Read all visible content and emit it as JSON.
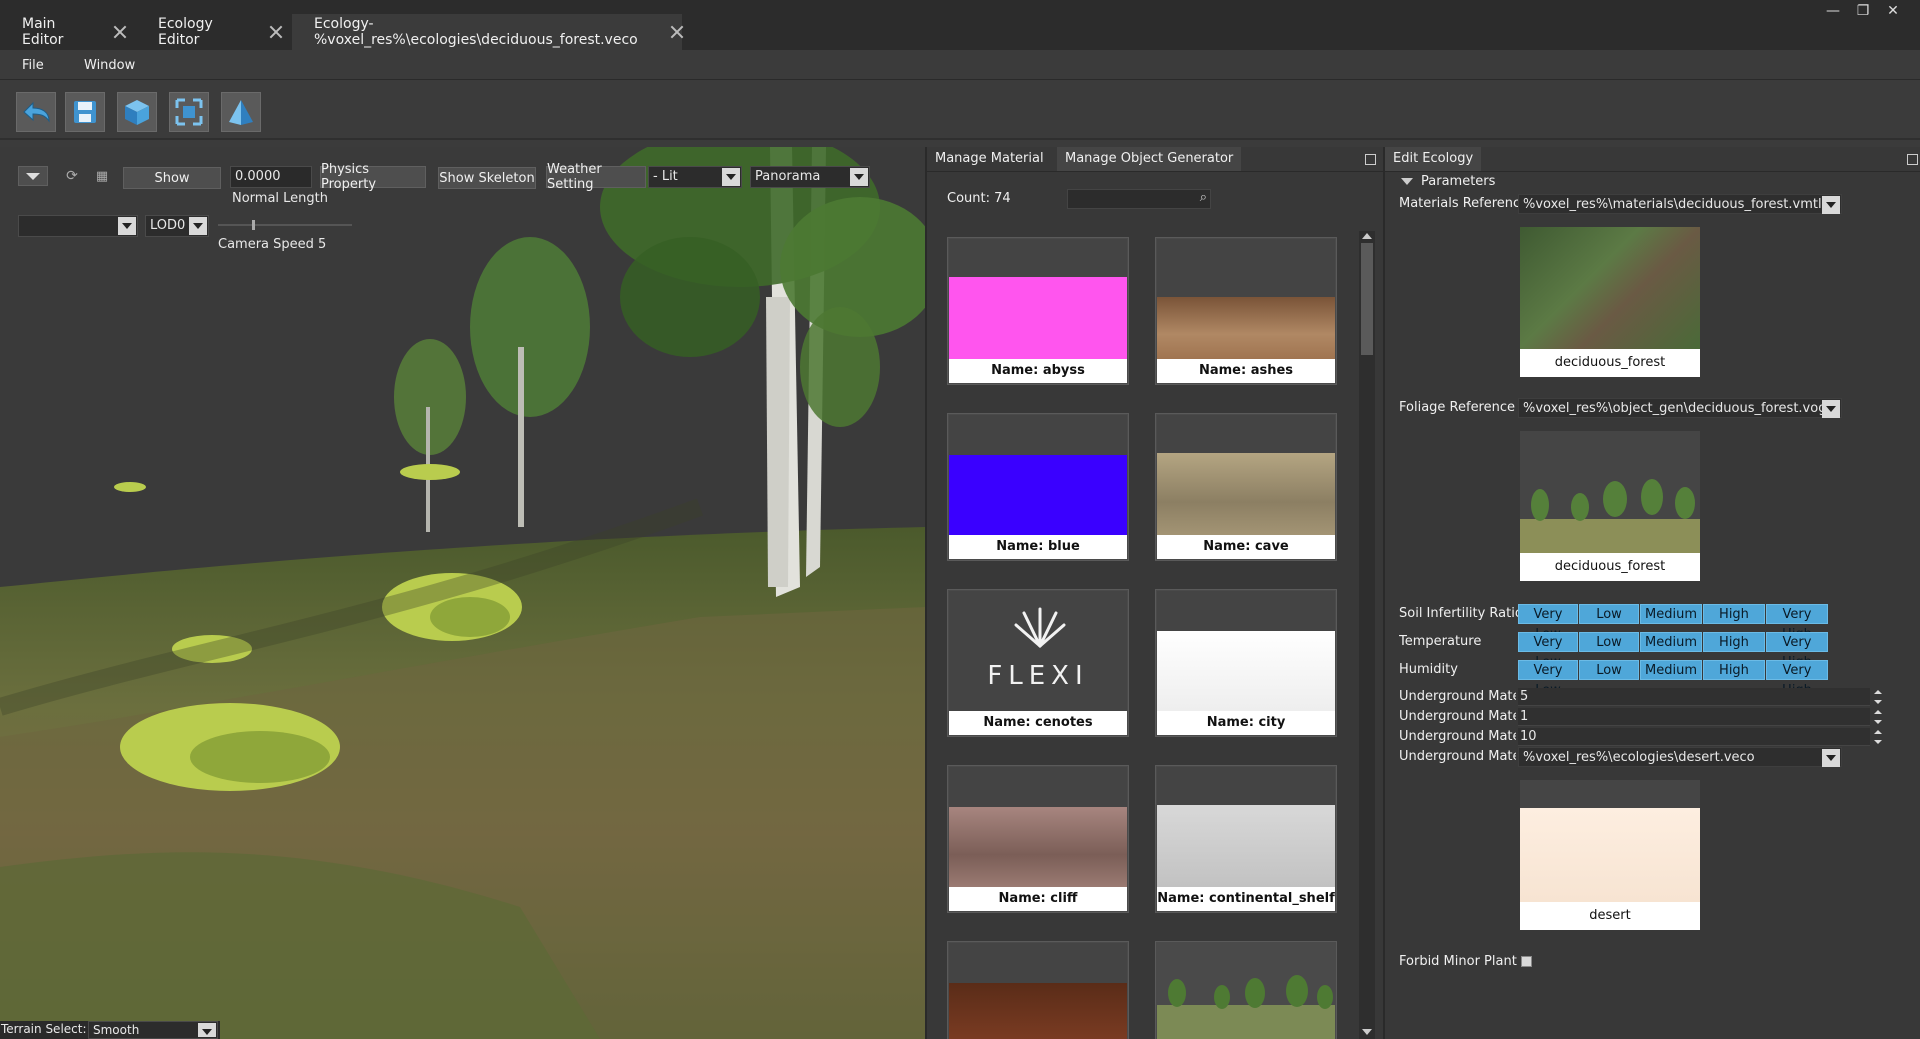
{
  "tabs": [
    {
      "label": "Main Editor",
      "active": false
    },
    {
      "label": "Ecology Editor",
      "active": false
    },
    {
      "label": "Ecology-%voxel_res%\\ecologies\\deciduous_forest.veco",
      "active": true
    }
  ],
  "window_controls": {
    "minimize": "—",
    "restore": "❐",
    "close": "✕"
  },
  "menu": [
    "File",
    "Window"
  ],
  "toolbar": [
    "undo-icon",
    "save-icon",
    "cube-icon",
    "frame-select-icon",
    "pyramid-icon"
  ],
  "viewport": {
    "show_label": "Show",
    "normal_length_value": "0.0000",
    "normal_length_label": "Normal Length",
    "physics_property_label": "Physics Property",
    "show_skeleton_label": "Show Skeleton",
    "weather_setting_label": "Weather Setting",
    "lit_select": "- Lit",
    "panorama_select": "Panorama",
    "lod_select": "LOD0",
    "first_select": "",
    "camera_speed_label": "Camera Speed 5",
    "terrain_select_label": "Terrain Select:",
    "terrain_select_value": "Smooth"
  },
  "material_panel": {
    "tab_manage_material": "Manage Material",
    "tab_manage_object_generator": "Manage Object Generator",
    "count_label": "Count: 74",
    "search_value": "",
    "items": [
      {
        "name": "Name: abyss",
        "color": "#ff55ee"
      },
      {
        "name": "Name: ashes",
        "color": "#a0704f"
      },
      {
        "name": "Name: blue",
        "color": "#3a00ff"
      },
      {
        "name": "Name: cave",
        "color": "#9a8c70"
      },
      {
        "name": "Name: cenotes",
        "color": "#444444",
        "logo": "FLEXI"
      },
      {
        "name": "Name: city",
        "color": "#f2f2f2"
      },
      {
        "name": "Name: cliff",
        "color": "#8c6a66"
      },
      {
        "name": "Name: continental_shelf",
        "color": "#d0d0d0"
      },
      {
        "name": "",
        "color": "#6b3520"
      },
      {
        "name": "",
        "color": "#7c8a55"
      }
    ]
  },
  "eco_panel": {
    "title": "Edit Ecology",
    "section": "Parameters",
    "materials_reference_label": "Materials Reference",
    "materials_reference_value": "%voxel_res%\\materials\\deciduous_forest.vmtl",
    "materials_preview_caption": "deciduous_forest",
    "foliage_reference_label": "Foliage Reference",
    "foliage_reference_value": "%voxel_res%\\object_gen\\deciduous_forest.vog",
    "foliage_preview_caption": "deciduous_forest",
    "levels": [
      "Very Low",
      "Low",
      "Medium",
      "High",
      "Very High"
    ],
    "soil_infertility_label": "Soil Infertility Ratio",
    "temperature_label": "Temperature",
    "humidity_label": "Humidity",
    "underground_rows": [
      {
        "label": "Underground Material Depth",
        "value": "5"
      },
      {
        "label": "Underground Material Count",
        "value": "1"
      },
      {
        "label": "Underground Material Scale",
        "value": "10"
      }
    ],
    "underground_ecology_label": "Underground Material",
    "underground_ecology_value": "%voxel_res%\\ecologies\\desert.veco",
    "desert_preview_caption": "desert",
    "forbid_minor_plant_label": "Forbid Minor Plant"
  }
}
